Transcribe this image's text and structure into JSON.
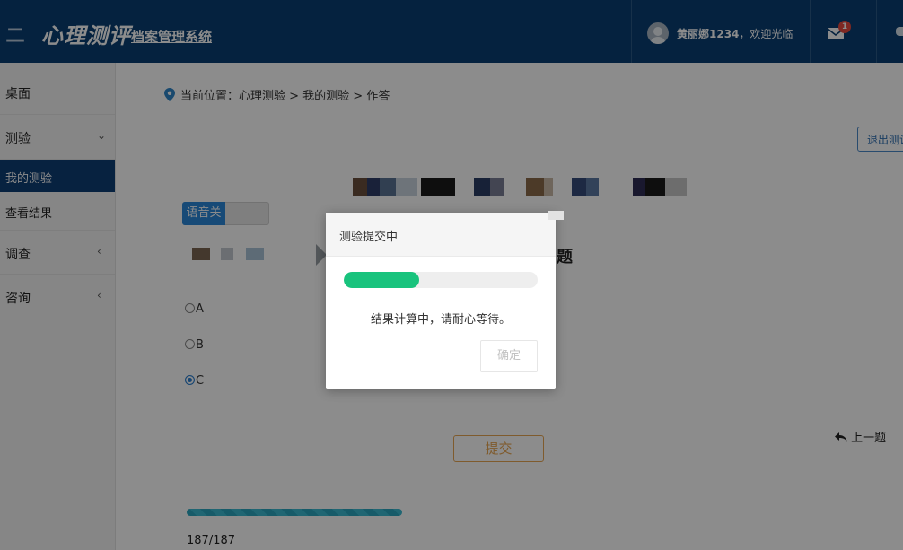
{
  "header": {
    "brand_prefix": "二",
    "logo": "心理测评",
    "subtitle": "档案管理系统",
    "user_name": "黄丽娜1234",
    "welcome_suffix": "，欢迎光临",
    "mail_badge": "1"
  },
  "sidebar": {
    "items": [
      {
        "label": "桌面"
      },
      {
        "label": "测验",
        "arrow": "⌄"
      },
      {
        "label": "我的测验"
      },
      {
        "label": "查看结果"
      },
      {
        "label": "调查",
        "arrow": "‹"
      },
      {
        "label": "咨询",
        "arrow": "‹"
      }
    ]
  },
  "breadcrumb": {
    "prefix": "当前位置：",
    "path": "心理测验 > 我的测验 > 作答"
  },
  "exit_button": "退出测试",
  "voice_toggle": {
    "label": "语音关"
  },
  "question": {
    "tail": "题"
  },
  "options": [
    {
      "letter": "A",
      "checked": false
    },
    {
      "letter": "B",
      "checked": false
    },
    {
      "letter": "C",
      "checked": true
    }
  ],
  "submit_label": "提交",
  "prev_label": "上一题",
  "progress": {
    "count_text": "187/187",
    "fraction": 1.0
  },
  "colors": {
    "header": "#0a3f73",
    "accent_green": "#19c37d",
    "submit": "#e8a652"
  },
  "modal": {
    "title": "测验提交中",
    "message": "结果计算中，请耐心等待。",
    "ok_label": "确定",
    "progress_fraction": 0.39
  }
}
